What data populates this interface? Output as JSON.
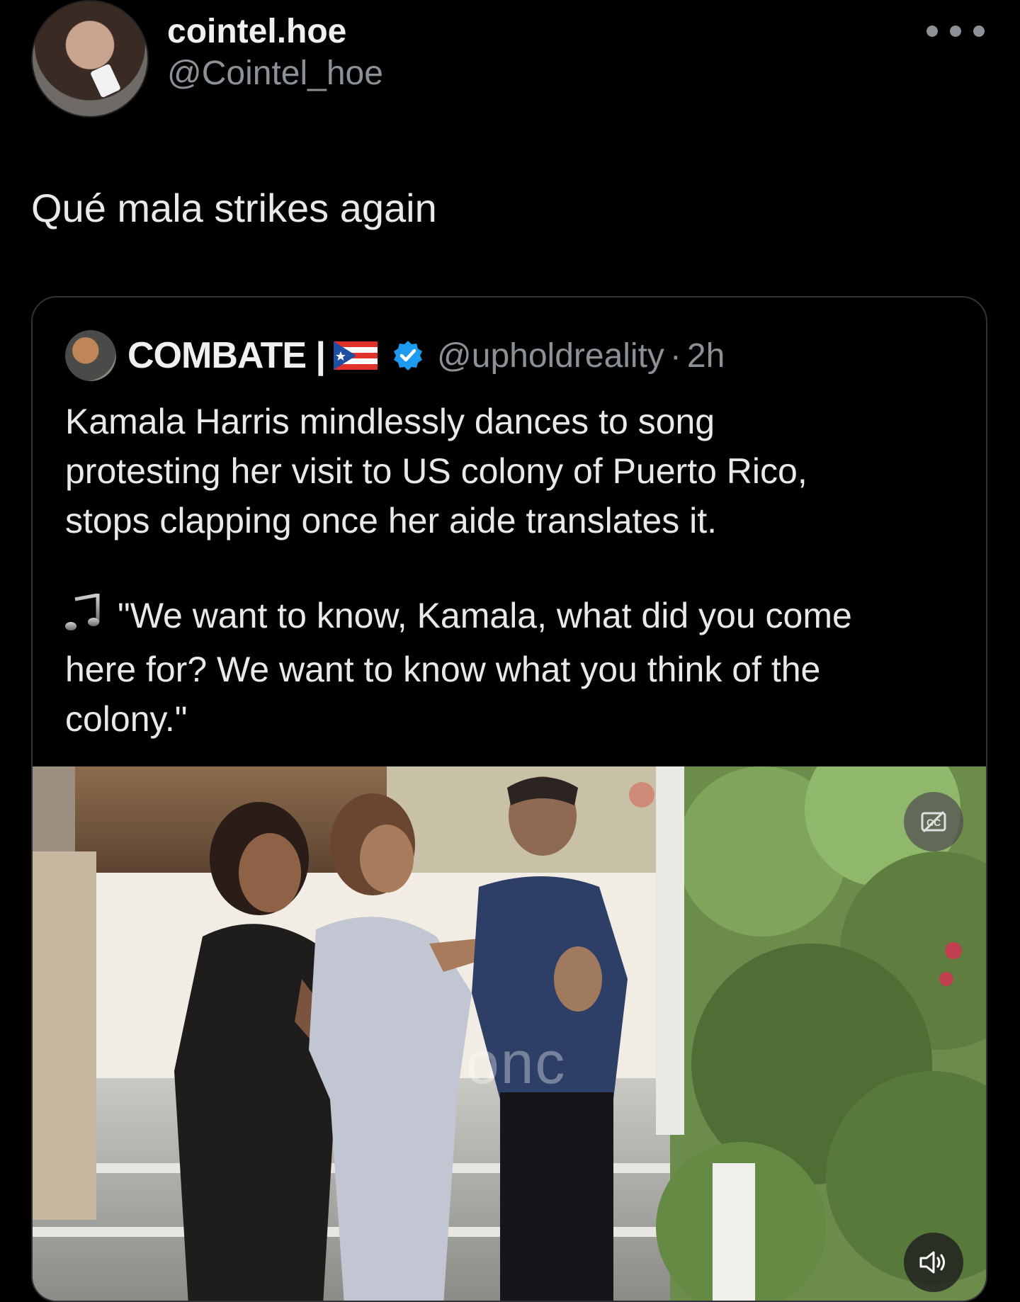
{
  "post": {
    "display_name": "cointel.hoe",
    "handle": "@Cointel_hoe",
    "text": "Qué mala strikes again",
    "avatar_icon": "avatar-photo",
    "more_icon": "more-options-icon"
  },
  "quoted": {
    "display_name": "COMBATE |",
    "flag_icon": "puerto-rico-flag-icon",
    "verified_icon": "verified-badge-icon",
    "handle": "@upholdreality",
    "separator": "·",
    "time": "2h",
    "text_lines": [
      "Kamala Harris mindlessly dances to song",
      "protesting her visit to US colony of Puerto Rico,",
      "stops clapping once her aide translates it."
    ],
    "quote_lines": [
      "\"We want to know, Kamala, what did you come",
      "here for? We want to know what you think of the",
      "colony.\""
    ],
    "music_icon": "music-note-icon",
    "media": {
      "watermark": "onc",
      "captions_icon": "captions-off-icon",
      "volume_icon": "volume-icon"
    }
  },
  "colors": {
    "background": "#000000",
    "text_primary": "#e7e9ea",
    "text_secondary": "#8b9196",
    "border": "#2f3336",
    "verified": "#1d9bf0"
  }
}
